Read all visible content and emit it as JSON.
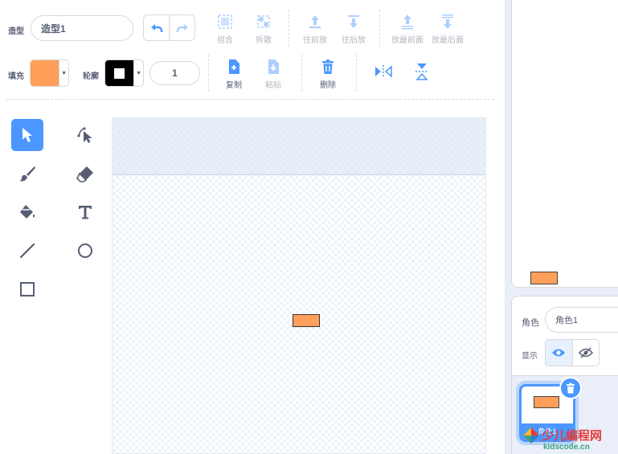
{
  "toolbar": {
    "costume_label": "造型",
    "costume_name": "造型1",
    "group_label": "组合",
    "ungroup_label": "拆散",
    "forward_label": "往前放",
    "backward_label": "往后放",
    "front_label": "放最前面",
    "back_label": "放最后面",
    "fill_label": "填充",
    "fill_color": "#ff9f5a",
    "outline_label": "轮廓",
    "outline_color": "#000000",
    "outline_width": "1",
    "copy_label": "复制",
    "paste_label": "粘贴",
    "delete_label": "删除"
  },
  "tools": [
    "select-tool",
    "reshape-tool",
    "brush-tool",
    "eraser-tool",
    "fill-tool",
    "text-tool",
    "line-tool",
    "circle-tool",
    "rect-tool"
  ],
  "colors": {
    "accent": "#4c97ff",
    "shape_fill": "#ff9f5a"
  },
  "sprite": {
    "label": "角色",
    "name": "角色1",
    "show_label": "显示",
    "card_name": "角色1"
  },
  "watermark": {
    "title": "少儿编程网",
    "url": "kidscode.cn"
  }
}
